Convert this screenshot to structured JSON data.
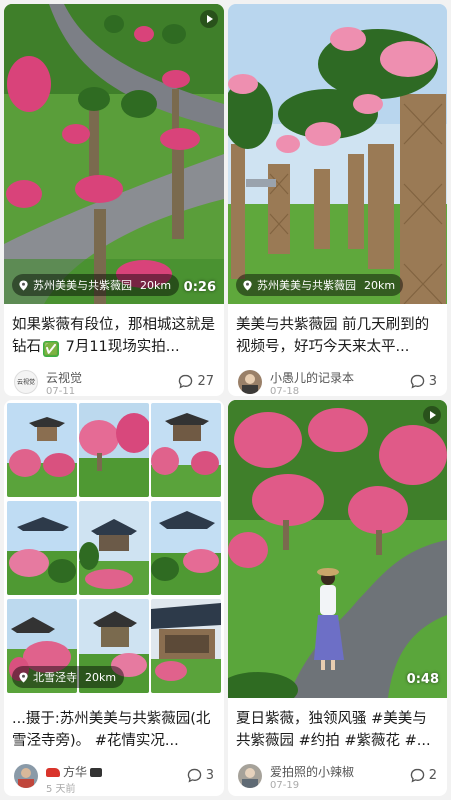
{
  "cards": [
    {
      "location": "苏州美美与共紫薇园",
      "distance": "20km",
      "duration": "0:26",
      "title": "如果紫薇有段位，那相城这就是钻石",
      "title_rest": "7月11现场实拍...",
      "title_emoji": "✅",
      "author": "云视觉",
      "date": "07-11",
      "comments": "27",
      "avatar_text": "云视觉"
    },
    {
      "location": "苏州美美与共紫薇园",
      "distance": "20km",
      "title": "美美与共紫薇园 前几天刷到的视频号，好巧今天来太平...",
      "author": "小愚儿的记录本",
      "date": "07-18",
      "comments": "3"
    },
    {
      "location": "北雪泾寺",
      "distance": "20km",
      "title": "...摄于:苏州美美与共紫薇园(北雪泾寺旁)。 #花情实况...",
      "author": "方华",
      "date": "5 天前",
      "comments": "3"
    },
    {
      "duration": "0:48",
      "title": "夏日紫薇，独领风骚 #美美与共紫薇园 #约拍 #紫薇花 #...",
      "author": "爱拍照的小辣椒",
      "date": "07-19",
      "comments": "2"
    }
  ],
  "icons": {
    "play": "play-icon",
    "pin": "location-pin-icon",
    "comment": "comment-bubble-icon"
  },
  "colors": {
    "background": "#f2f2f2",
    "card": "#ffffff",
    "grass": "#4f9a33",
    "blossom": "#e05a88"
  }
}
